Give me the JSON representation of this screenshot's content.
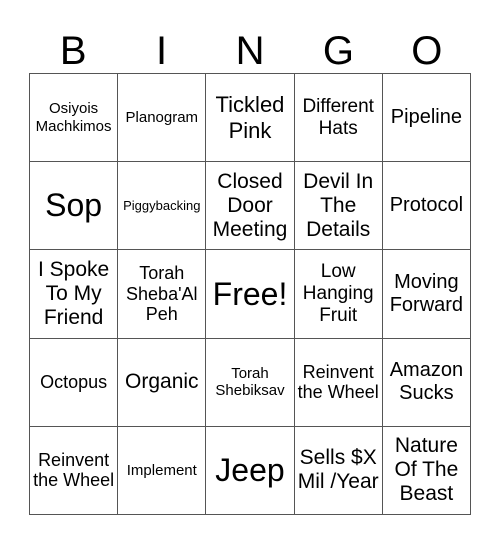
{
  "header": {
    "letters": [
      "B",
      "I",
      "N",
      "G",
      "O"
    ]
  },
  "card": {
    "rows": [
      [
        "Osiyois Machkimos",
        "Planogram",
        "Tickled Pink",
        "Different Hats",
        "Pipeline"
      ],
      [
        "Sop",
        "Piggybacking",
        "Closed Door Meeting",
        "Devil In The Details",
        "Protocol"
      ],
      [
        "I Spoke To My Friend",
        "Torah Sheba'Al Peh",
        "Free!",
        "Low Hanging Fruit",
        "Moving Forward"
      ],
      [
        "Octopus",
        "Organic",
        "Torah Shebiksav",
        "Reinvent the Wheel",
        "Amazon Sucks"
      ],
      [
        "Reinvent the Wheel",
        "Implement",
        "Jeep",
        "Sells $X Mil /Year",
        "Nature Of The Beast"
      ]
    ]
  }
}
